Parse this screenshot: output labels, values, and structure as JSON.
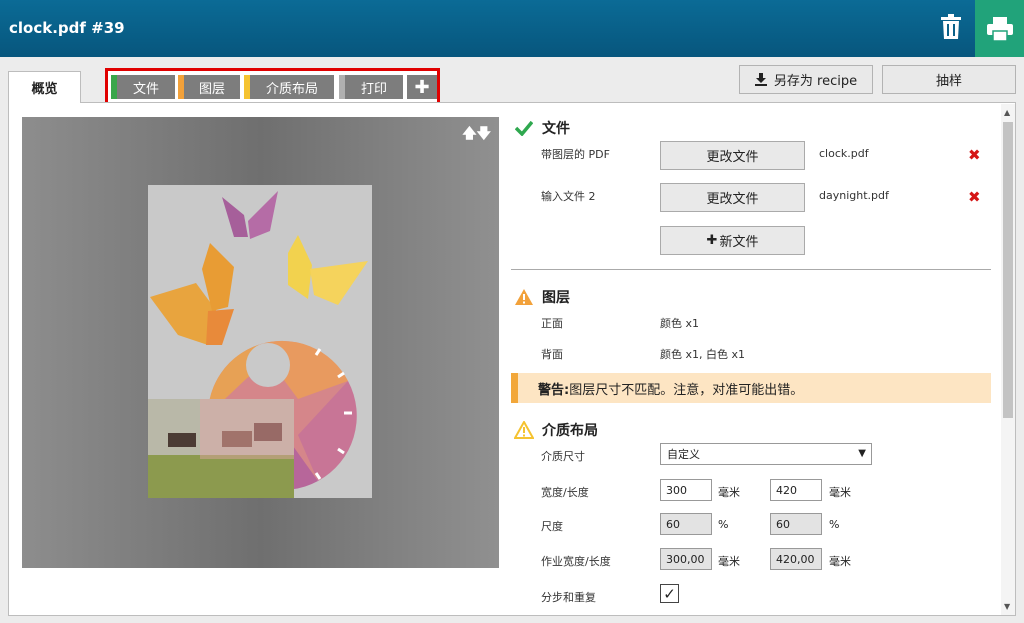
{
  "header": {
    "title": "clock.pdf #39"
  },
  "tabs": {
    "overview": "概览",
    "steps": [
      {
        "label": "文件",
        "color": "#3aa64b"
      },
      {
        "label": "图层",
        "color": "#f2a13a"
      },
      {
        "label": "介质布局",
        "color": "#f5c331"
      },
      {
        "label": "打印",
        "color": "#b0b0b0"
      }
    ],
    "add_symbol": "✚"
  },
  "actions": {
    "save_recipe": "另存为 recipe",
    "sample": "抽样"
  },
  "files_section": {
    "title": "文件",
    "rows": [
      {
        "label": "带图层的 PDF",
        "button": "更改文件",
        "filename": "clock.pdf"
      },
      {
        "label": "输入文件 2",
        "button": "更改文件",
        "filename": "daynight.pdf"
      }
    ],
    "new_file_button": "新文件"
  },
  "layers_section": {
    "title": "图层",
    "rows": [
      {
        "label": "正面",
        "value": "颜色 x1"
      },
      {
        "label": "背面",
        "value": "颜色 x1, 白色 x1"
      }
    ],
    "warning_prefix": "警告:",
    "warning_text": " 图层尺寸不匹配。注意，对准可能出错。"
  },
  "media_section": {
    "title": "介质布局",
    "media_size_label": "介质尺寸",
    "media_size_value": "自定义",
    "width_length_label": "宽度/长度",
    "width": "300",
    "length": "420",
    "unit_mm": "毫米",
    "scale_label": "尺度",
    "scale_x": "60",
    "scale_y": "60",
    "unit_pct": "%",
    "job_size_label": "作业宽度/长度",
    "job_width": "300,00",
    "job_length": "420,00",
    "step_repeat_label": "分步和重复",
    "step_repeat_checked": "✓"
  }
}
